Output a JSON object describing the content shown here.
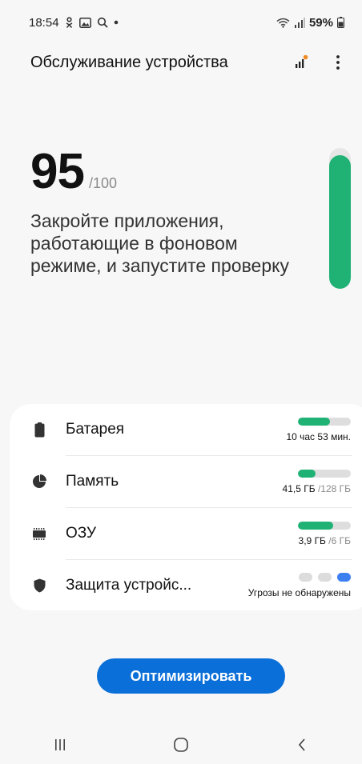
{
  "status_bar": {
    "time": "18:54",
    "battery_percent": "59%",
    "icons": [
      "odnoklassniki-icon",
      "gallery-icon",
      "search-icon",
      "dot-icon",
      "wifi-icon",
      "signal-icon",
      "battery-icon"
    ]
  },
  "header": {
    "title": "Обслуживание устройства",
    "actions": [
      "stats-icon",
      "more-options-icon"
    ],
    "badge_color": "#f08a24"
  },
  "score": {
    "value": "95",
    "max": "/100",
    "fraction": 0.95,
    "message": "Закройте приложения, работающие в фоновом режиме, и запустите проверку"
  },
  "items": [
    {
      "label": "Батарея",
      "icon": "battery-icon",
      "value": "10 час 53 мин.",
      "extra": "",
      "bar_fraction": 0.6
    },
    {
      "label": "Память",
      "icon": "storage-pie-icon",
      "value": "41,5 ГБ",
      "extra": "/128 ГБ",
      "bar_fraction": 0.33
    },
    {
      "label": "ОЗУ",
      "icon": "ram-chip-icon",
      "value": "3,9 ГБ",
      "extra": "/6 ГБ",
      "bar_fraction": 0.66
    },
    {
      "label": "Защита устройс...",
      "icon": "shield-icon",
      "value": "Угрозы не обнаружены",
      "extra": "",
      "security_level": "3 of 3"
    }
  ],
  "colors": {
    "accent_green": "#1fb274",
    "primary_blue": "#0a6fd8",
    "dot_blue": "#3b7ff1"
  },
  "optimize_button": {
    "label": "Оптимизировать"
  },
  "nav_bar": {
    "buttons": [
      "recents-icon",
      "home-icon",
      "back-icon"
    ]
  }
}
